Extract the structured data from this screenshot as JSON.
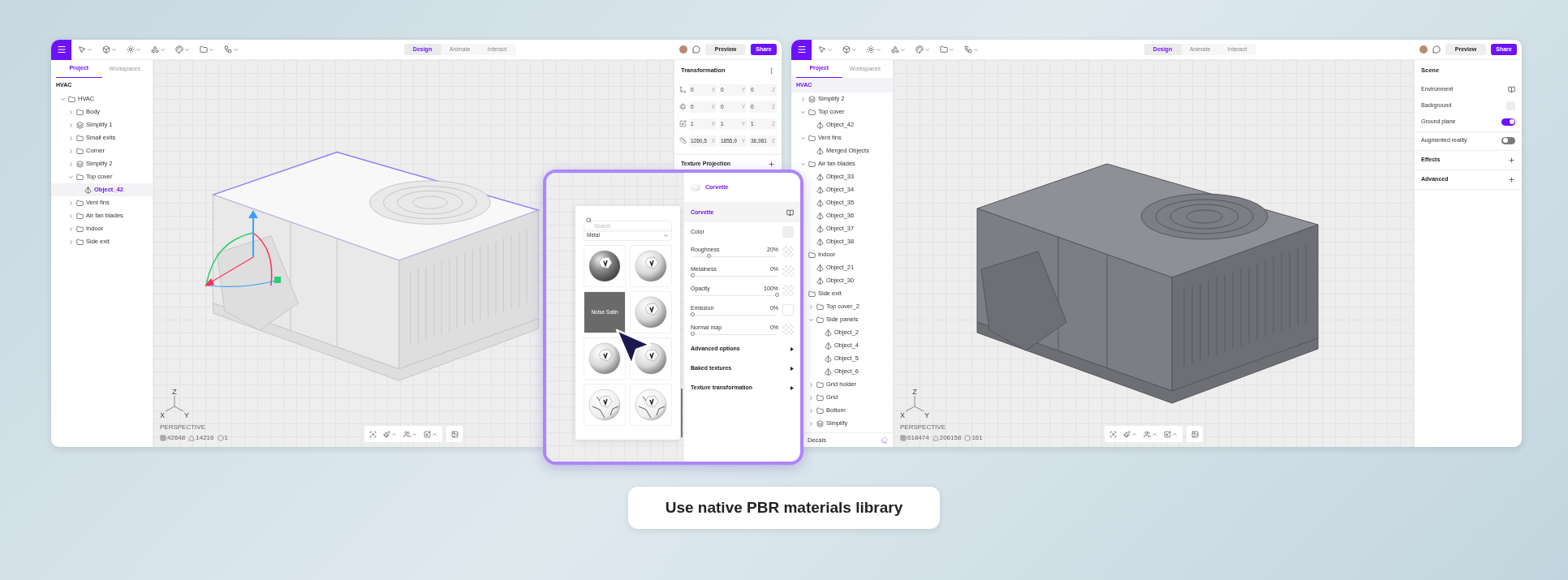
{
  "windows": [
    {
      "toolbar": {
        "modes": [
          {
            "label": "Design",
            "selected": true
          },
          {
            "label": "Animate",
            "selected": false
          },
          {
            "label": "Interact",
            "selected": false
          }
        ],
        "preview": "Preview",
        "share": "Share"
      },
      "sidebar": {
        "tabs": [
          {
            "label": "Project",
            "selected": true
          },
          {
            "label": "Workspaces",
            "selected": false
          }
        ],
        "title": {
          "label": "HVAC",
          "selected": false
        },
        "tree": [
          {
            "label": "HVAC",
            "kind": "folder",
            "expanded": true,
            "selected": false,
            "children": [
              {
                "label": "Body",
                "kind": "folder",
                "expanded": false,
                "selected": false
              },
              {
                "label": "Simplify 1",
                "kind": "simplify",
                "expanded": false,
                "selected": false
              },
              {
                "label": "Small exits",
                "kind": "folder",
                "expanded": false,
                "selected": false
              },
              {
                "label": "Corner",
                "kind": "folder",
                "expanded": false,
                "selected": false
              },
              {
                "label": "Simplify 2",
                "kind": "simplify",
                "expanded": false,
                "selected": false
              },
              {
                "label": "Top cover",
                "kind": "folder",
                "expanded": true,
                "selected": false,
                "children": [
                  {
                    "label": "Object_42",
                    "kind": "object",
                    "selected": true
                  }
                ]
              },
              {
                "label": "Vent fins",
                "kind": "folder",
                "expanded": false,
                "selected": false
              },
              {
                "label": "Air fan blades",
                "kind": "folder",
                "expanded": false,
                "selected": false
              },
              {
                "label": "Indoor",
                "kind": "folder",
                "expanded": false,
                "selected": false
              },
              {
                "label": "Side exit",
                "kind": "folder",
                "expanded": false,
                "selected": false
              }
            ]
          }
        ]
      },
      "viewport": {
        "model": {
          "kind": "light",
          "selected": true
        },
        "gizmo": true,
        "camera": "PERSPECTIVE",
        "axes": [
          "Z",
          "X",
          "Y"
        ],
        "stats": [
          "42648",
          "14216",
          "1"
        ]
      },
      "panel": {
        "kind": "transform",
        "title": "Transformation",
        "rows": [
          {
            "kind": "position",
            "values": [
              {
                "value": "0",
                "axis": "X"
              },
              {
                "value": "0",
                "axis": "Y"
              },
              {
                "value": "0",
                "axis": "Z"
              }
            ]
          },
          {
            "kind": "rotation",
            "values": [
              {
                "value": "0",
                "axis": "X"
              },
              {
                "value": "0",
                "axis": "Y"
              },
              {
                "value": "0",
                "axis": "Z"
              }
            ]
          },
          {
            "kind": "scale",
            "values": [
              {
                "value": "1",
                "axis": "X"
              },
              {
                "value": "1",
                "axis": "Y"
              },
              {
                "value": "1",
                "axis": "Z"
              }
            ]
          },
          {
            "kind": "size",
            "values": [
              {
                "value": "1260,5",
                "axis": "X"
              },
              {
                "value": "1855,9",
                "axis": "Y"
              },
              {
                "value": "36,981",
                "axis": "Z"
              }
            ]
          }
        ],
        "sections": [
          "Texture Projection"
        ]
      }
    },
    {
      "toolbar": {
        "modes": [
          {
            "label": "Design",
            "selected": true
          },
          {
            "label": "Animate",
            "selected": false
          },
          {
            "label": "Interact",
            "selected": false
          }
        ],
        "preview": "Preview",
        "share": "Share"
      },
      "sidebar": {
        "tabs": [
          {
            "label": "Project",
            "selected": true
          },
          {
            "label": "Workspaces",
            "selected": false
          }
        ],
        "title": {
          "label": "HVAC",
          "selected": true
        },
        "tree": [
          {
            "label": "Simplify 2",
            "kind": "simplify",
            "expanded": false,
            "selected": false
          },
          {
            "label": "Top cover",
            "kind": "folder",
            "expanded": true,
            "selected": false,
            "children": [
              {
                "label": "Object_42",
                "kind": "object",
                "selected": false
              }
            ]
          },
          {
            "label": "Vent fins",
            "kind": "folder",
            "expanded": true,
            "selected": false,
            "children": [
              {
                "label": "Merged Objects",
                "kind": "object",
                "selected": false
              }
            ]
          },
          {
            "label": "Air fan blades",
            "kind": "folder",
            "expanded": true,
            "selected": false,
            "children": [
              {
                "label": "Object_33",
                "kind": "object",
                "selected": false
              },
              {
                "label": "Object_34",
                "kind": "object",
                "selected": false
              },
              {
                "label": "Object_35",
                "kind": "object",
                "selected": false
              },
              {
                "label": "Object_36",
                "kind": "object",
                "selected": false
              },
              {
                "label": "Object_37",
                "kind": "object",
                "selected": false
              },
              {
                "label": "Object_38",
                "kind": "object",
                "selected": false
              }
            ]
          },
          {
            "label": "Indoor",
            "kind": "folder",
            "selected": false,
            "children": [
              {
                "label": "Object_21",
                "kind": "object",
                "selected": false
              },
              {
                "label": "Object_30",
                "kind": "object",
                "selected": false
              }
            ]
          },
          {
            "label": "Side exit",
            "kind": "folder",
            "selected": false,
            "children": [
              {
                "label": "Top cover_2",
                "kind": "folder",
                "expanded": false,
                "selected": false
              },
              {
                "label": "Side panels",
                "kind": "folder",
                "expanded": true,
                "selected": false,
                "children": [
                  {
                    "label": "Object_2",
                    "kind": "object",
                    "selected": false
                  },
                  {
                    "label": "Object_4",
                    "kind": "object",
                    "selected": false
                  },
                  {
                    "label": "Object_5",
                    "kind": "object",
                    "selected": false
                  },
                  {
                    "label": "Object_6",
                    "kind": "object",
                    "selected": false
                  }
                ]
              },
              {
                "label": "Grid holder",
                "kind": "folder",
                "expanded": false,
                "selected": false
              },
              {
                "label": "Grid",
                "kind": "folder",
                "expanded": false,
                "selected": false
              },
              {
                "label": "Bottom",
                "kind": "folder",
                "expanded": false,
                "selected": false
              },
              {
                "label": "Simplify",
                "kind": "simplify",
                "expanded": false,
                "selected": false
              }
            ]
          }
        ],
        "footer": "Decals"
      },
      "viewport": {
        "model": {
          "kind": "dark",
          "selected": false
        },
        "gizmo": false,
        "camera": "PERSPECTIVE",
        "axes": [
          "Z",
          "X",
          "Y"
        ],
        "stats": [
          "618474",
          "206158",
          "161"
        ]
      },
      "panel": {
        "kind": "scene",
        "title": "Scene",
        "groups": [
          [
            {
              "kind": "link",
              "label": "Environment"
            },
            {
              "kind": "swatch",
              "label": "Background"
            },
            {
              "kind": "toggle",
              "label": "Ground plane",
              "on": true
            }
          ],
          [
            {
              "kind": "toggle",
              "label": "Augmented reality",
              "on": false
            }
          ]
        ],
        "sections": [
          "Effects",
          "Advanced"
        ]
      }
    }
  ],
  "popup": {
    "library": {
      "search_placeholder": "Search",
      "category": "Metal",
      "materials": [
        {
          "kind": "dark",
          "hovered": false
        },
        {
          "kind": "chrome",
          "hovered": false
        },
        {
          "kind": "dark",
          "hovered": true,
          "label": "Noise Satin"
        },
        {
          "kind": "chrome",
          "hovered": false
        },
        {
          "kind": "chrome",
          "hovered": false
        },
        {
          "kind": "chrome",
          "hovered": false
        },
        {
          "kind": "cracked",
          "hovered": false
        },
        {
          "kind": "cracked",
          "hovered": false
        }
      ]
    },
    "editor": {
      "material": "Corvette",
      "section": "Corvette",
      "color_label": "Color",
      "properties": [
        {
          "label": "Roughness",
          "value": "20%",
          "level": 0.2,
          "kind": "texture"
        },
        {
          "label": "Metalness",
          "value": "0%",
          "level": 0,
          "kind": "texture"
        },
        {
          "label": "Opacity",
          "value": "100%",
          "level": 1,
          "kind": "texture"
        },
        {
          "label": "Emission",
          "value": "0%",
          "level": 0,
          "kind": "plain"
        },
        {
          "label": "Normal map",
          "value": "0%",
          "level": 0,
          "kind": "texture"
        }
      ],
      "groups": [
        "Advanced options",
        "Baked textures",
        "Texture transformation"
      ]
    }
  },
  "caption": "Use native PBR materials library"
}
